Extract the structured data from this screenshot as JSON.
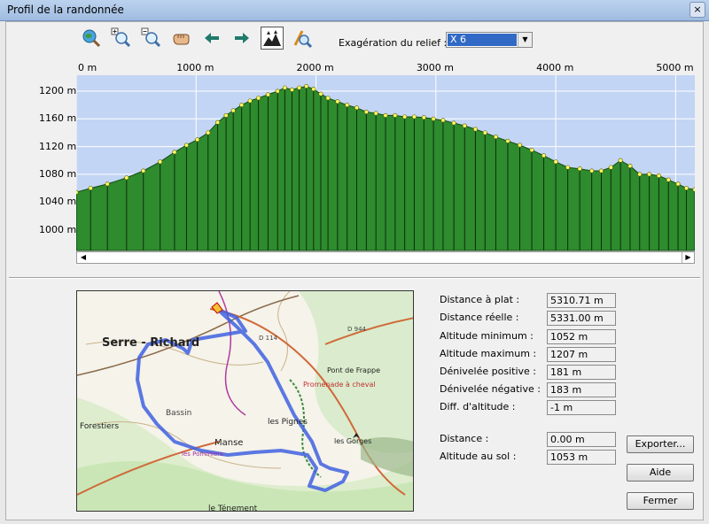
{
  "window": {
    "title": "Profil de la randonnée",
    "close_glyph": "×"
  },
  "toolbar": {
    "buttons": [
      {
        "icon": "globe-zoom-icon",
        "pressed": false
      },
      {
        "icon": "zoom-in-icon",
        "pressed": false
      },
      {
        "icon": "zoom-out-icon",
        "pressed": false
      },
      {
        "icon": "hand-pan-icon",
        "pressed": false
      },
      {
        "icon": "arrow-left-icon",
        "pressed": false
      },
      {
        "icon": "arrow-right-icon",
        "pressed": false
      },
      {
        "icon": "relief-profile-icon",
        "pressed": true
      },
      {
        "icon": "gradient-tool-icon",
        "pressed": false
      }
    ],
    "exaggeration_label": "Exagération du relief :",
    "exaggeration_value": "X 6"
  },
  "chart_data": {
    "type": "area",
    "x_axis_labels": [
      "0 m",
      "1000 m",
      "2000 m",
      "3000 m",
      "4000 m",
      "5000 m"
    ],
    "x_ticks": [
      0,
      1000,
      2000,
      3000,
      4000,
      5000
    ],
    "y_axis_labels": [
      "1200 m",
      "1160 m",
      "1120 m",
      "1080 m",
      "1040 m",
      "1000 m"
    ],
    "y_ticks": [
      1200,
      1160,
      1120,
      1080,
      1040,
      1000
    ],
    "xlim": [
      0,
      5160
    ],
    "ylim": [
      970,
      1223
    ],
    "grid": true,
    "fill_color": "#2e8b2e",
    "marker_color": "#ffff66",
    "background_color": "#c3d5f4",
    "points": [
      [
        0,
        1054
      ],
      [
        120,
        1060
      ],
      [
        260,
        1066
      ],
      [
        420,
        1075
      ],
      [
        560,
        1085
      ],
      [
        700,
        1098
      ],
      [
        820,
        1112
      ],
      [
        920,
        1122
      ],
      [
        1010,
        1130
      ],
      [
        1100,
        1140
      ],
      [
        1180,
        1155
      ],
      [
        1250,
        1165
      ],
      [
        1310,
        1172
      ],
      [
        1380,
        1180
      ],
      [
        1450,
        1186
      ],
      [
        1520,
        1190
      ],
      [
        1600,
        1195
      ],
      [
        1680,
        1200
      ],
      [
        1740,
        1205
      ],
      [
        1800,
        1202
      ],
      [
        1860,
        1205
      ],
      [
        1920,
        1207
      ],
      [
        1980,
        1203
      ],
      [
        2040,
        1196
      ],
      [
        2100,
        1190
      ],
      [
        2180,
        1185
      ],
      [
        2260,
        1180
      ],
      [
        2340,
        1176
      ],
      [
        2420,
        1170
      ],
      [
        2500,
        1168
      ],
      [
        2580,
        1165
      ],
      [
        2660,
        1165
      ],
      [
        2740,
        1163
      ],
      [
        2820,
        1163
      ],
      [
        2900,
        1162
      ],
      [
        2980,
        1160
      ],
      [
        3060,
        1158
      ],
      [
        3150,
        1154
      ],
      [
        3240,
        1150
      ],
      [
        3330,
        1145
      ],
      [
        3410,
        1140
      ],
      [
        3500,
        1134
      ],
      [
        3600,
        1128
      ],
      [
        3700,
        1122
      ],
      [
        3800,
        1115
      ],
      [
        3900,
        1107
      ],
      [
        4000,
        1098
      ],
      [
        4100,
        1090
      ],
      [
        4200,
        1088
      ],
      [
        4300,
        1085
      ],
      [
        4380,
        1085
      ],
      [
        4460,
        1090
      ],
      [
        4540,
        1100
      ],
      [
        4620,
        1092
      ],
      [
        4700,
        1080
      ],
      [
        4780,
        1080
      ],
      [
        4860,
        1078
      ],
      [
        4940,
        1072
      ],
      [
        5020,
        1066
      ],
      [
        5090,
        1060
      ],
      [
        5160,
        1058
      ]
    ]
  },
  "map": {
    "labels": {
      "serre": "Serre - Richard",
      "forestiers": "Forestiers",
      "bassin": "Bassin",
      "manse": "Manse",
      "pignes": "les Pignes",
      "pommiers": "les Pommiers",
      "tenement": "le Ténement",
      "pont": "Pont de Frappe",
      "promenade": "Promenade à cheval",
      "gorges": "les Gorges",
      "d114": "D 114",
      "d944": "D 944"
    },
    "route_color": "#4060e0"
  },
  "stats": [
    {
      "label": "Distance à plat :",
      "value": "5310.71 m"
    },
    {
      "label": "Distance réelle :",
      "value": "5331.00 m"
    },
    {
      "label": "Altitude minimum :",
      "value": "1052 m"
    },
    {
      "label": "Altitude maximum :",
      "value": "1207 m"
    },
    {
      "label": "Dénivelée positive :",
      "value": "181 m"
    },
    {
      "label": "Dénivelée négative :",
      "value": "183 m"
    },
    {
      "label": "Diff. d'altitude :",
      "value": "-1 m"
    }
  ],
  "cursor": [
    {
      "label": "Distance :",
      "value": "0.00 m"
    },
    {
      "label": "Altitude au sol :",
      "value": "1053 m"
    }
  ],
  "buttons": {
    "export": "Exporter...",
    "help": "Aide",
    "close": "Fermer"
  },
  "scroll": {
    "left_glyph": "◀",
    "right_glyph": "▶"
  },
  "dropdown_glyph": "▼"
}
